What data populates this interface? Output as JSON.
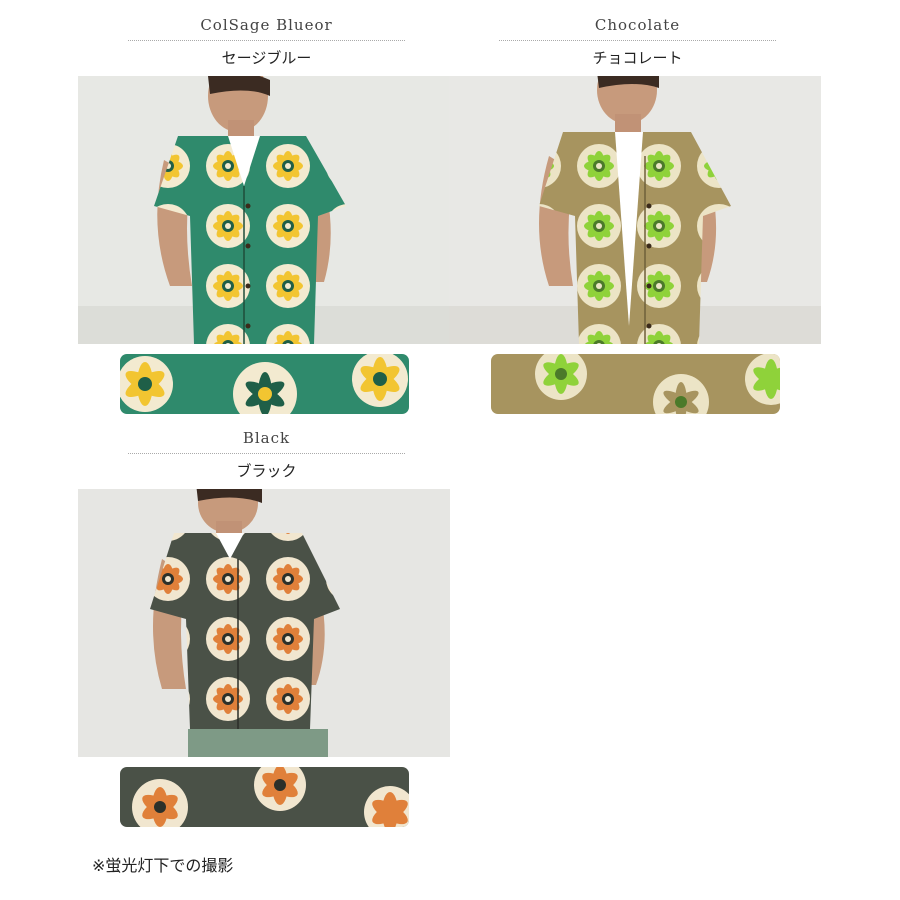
{
  "variants": [
    {
      "name_en": "ColSage Blueor",
      "name_jp": "セージブルー",
      "colors": {
        "shirt": "#2f8a6c",
        "flower_main": "#f2c531",
        "flower_light": "#f3ead0",
        "flower_dark": "#1f5f48",
        "bg": "#e7e8e4"
      }
    },
    {
      "name_en": "Chocolate",
      "name_jp": "チョコレート",
      "colors": {
        "shirt": "#a7945f",
        "flower_main": "#8fd23a",
        "flower_light": "#ece4c6",
        "flower_dark": "#4b7a2a",
        "bg": "#e8e8e5"
      }
    },
    {
      "name_en": "Black",
      "name_jp": "ブラック",
      "colors": {
        "shirt": "#4a5147",
        "flower_main": "#e0803a",
        "flower_light": "#f1e6cf",
        "flower_dark": "#2c302a",
        "bg": "#e6e6e3"
      }
    }
  ],
  "note": "※蛍光灯下での撮影"
}
